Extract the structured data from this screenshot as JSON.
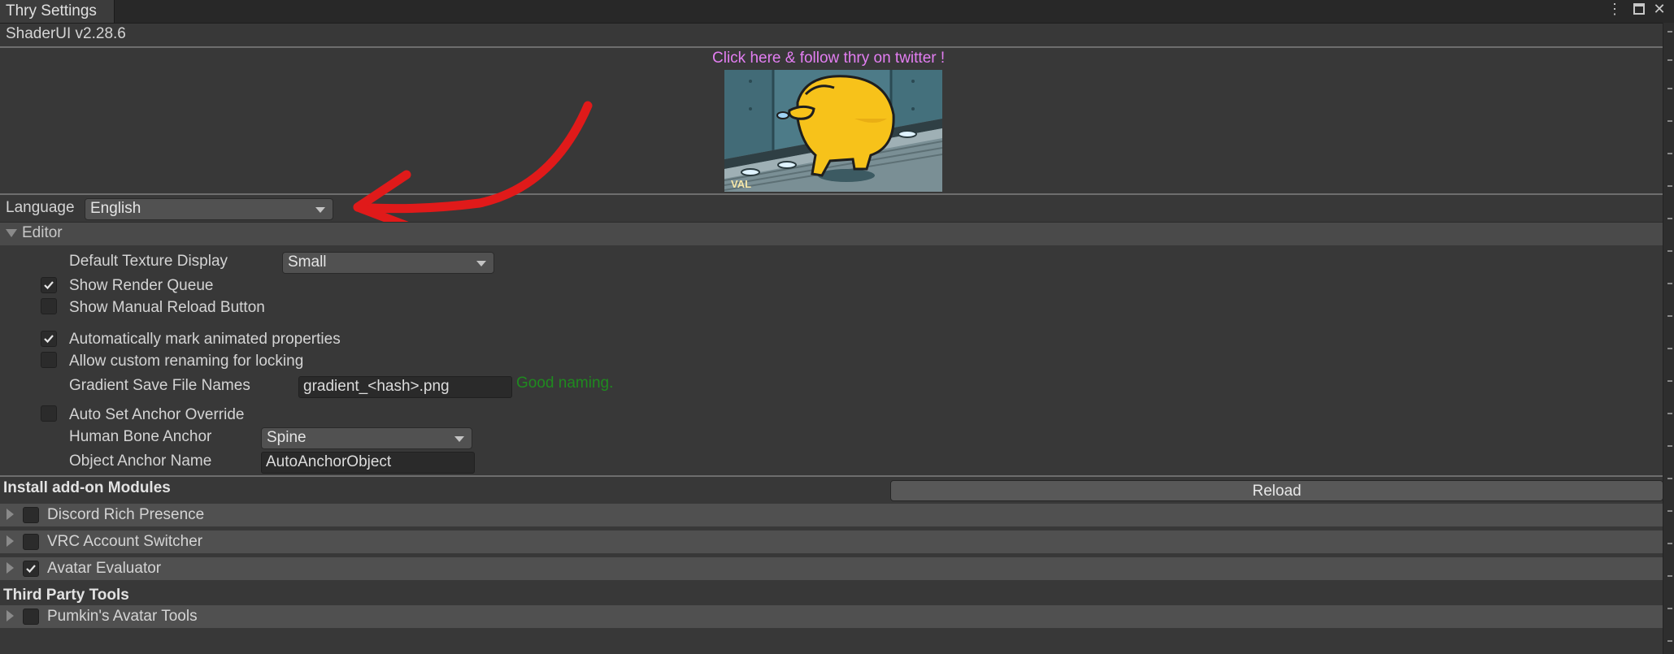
{
  "window": {
    "tab_title": "Thry Settings",
    "menu_icon": "kebab-menu-icon",
    "maximize_icon": "maximize-icon",
    "close_icon": "close-icon"
  },
  "version": "ShaderUI v2.28.6",
  "banner": {
    "link_text": "Click here & follow thry on twitter !",
    "link_color": "#e37ef2",
    "image_watermark": "VAL"
  },
  "language": {
    "label": "Language",
    "value": "English"
  },
  "editor": {
    "header": "Editor",
    "default_texture_display": {
      "label": "Default Texture Display",
      "value": "Small"
    },
    "show_render_queue": {
      "label": "Show Render Queue",
      "checked": true
    },
    "show_manual_reload": {
      "label": "Show Manual Reload Button",
      "checked": false
    },
    "auto_mark_animated": {
      "label": "Automatically mark animated properties",
      "checked": true
    },
    "allow_custom_renaming": {
      "label": "Allow custom renaming for locking",
      "checked": false
    },
    "gradient_names": {
      "label": "Gradient Save File Names",
      "value": "gradient_<hash>.png",
      "status": "Good naming.",
      "status_color": "#1f8a1f"
    },
    "auto_anchor_override": {
      "label": "Auto Set Anchor Override",
      "checked": false
    },
    "human_bone_anchor": {
      "label": "Human Bone Anchor",
      "value": "Spine"
    },
    "object_anchor_name": {
      "label": "Object Anchor Name",
      "value": "AutoAnchorObject"
    }
  },
  "modules": {
    "header": "Install add-on Modules",
    "reload_label": "Reload",
    "items": [
      {
        "label": "Discord Rich Presence",
        "checked": false
      },
      {
        "label": "VRC Account Switcher",
        "checked": false
      },
      {
        "label": "Avatar Evaluator",
        "checked": true
      }
    ]
  },
  "third_party": {
    "header": "Third Party Tools",
    "items": [
      {
        "label": "Pumkin's Avatar Tools",
        "checked": false
      }
    ]
  },
  "annotation_color": "#e01a1a"
}
